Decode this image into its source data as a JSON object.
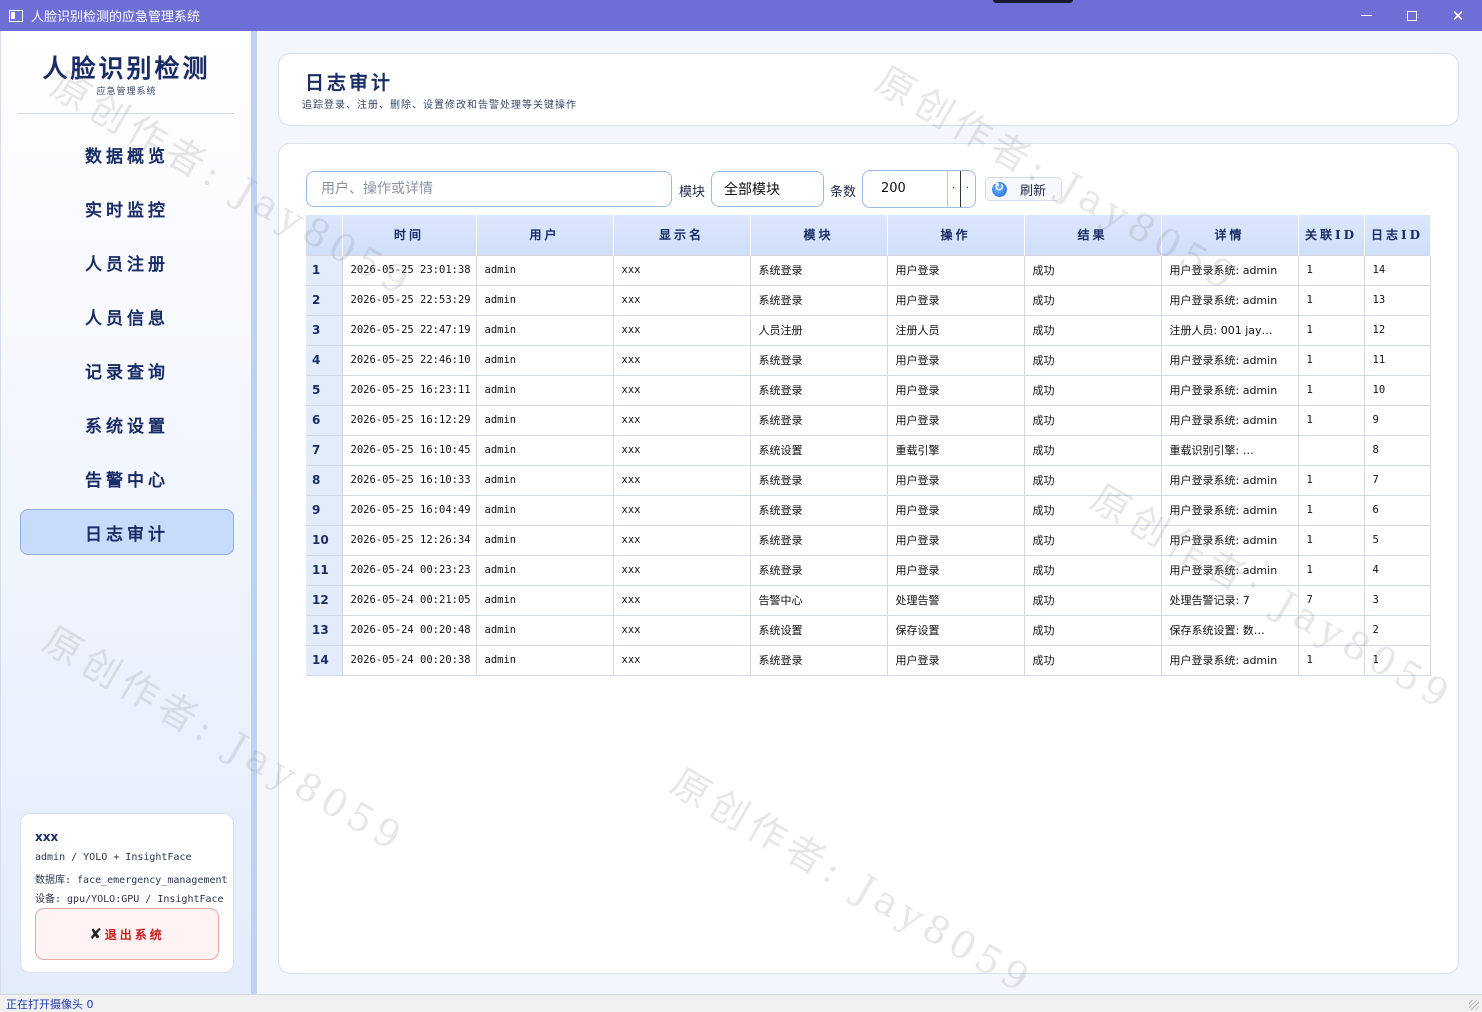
{
  "window": {
    "title": "人脸识别检测的应急管理系统"
  },
  "sidebar": {
    "brand_title": "人脸识别检测",
    "brand_subtitle": "应急管理系统",
    "nav": [
      {
        "label": "数据概览"
      },
      {
        "label": "实时监控"
      },
      {
        "label": "人员注册"
      },
      {
        "label": "人员信息"
      },
      {
        "label": "记录查询"
      },
      {
        "label": "系统设置"
      },
      {
        "label": "告警中心"
      },
      {
        "label": "日志审计",
        "active": true
      }
    ],
    "user": {
      "name": "xxx",
      "role_line": "admin / YOLO + InsightFace",
      "db_line": "数据库: face_emergency_management",
      "device_line": "设备: gpu/YOLO:GPU / InsightFace"
    },
    "logout_label": "退出系统"
  },
  "header": {
    "title": "日志审计",
    "subtitle": "追踪登录、注册、删除、设置修改和告警处理等关键操作"
  },
  "filters": {
    "search_placeholder": "用户、操作或详情",
    "module_label": "模块",
    "module_value": "全部模块",
    "count_label": "条数",
    "count_value": "200",
    "refresh_label": "刷新"
  },
  "table": {
    "columns": [
      "时间",
      "用户",
      "显示名",
      "模块",
      "操作",
      "结果",
      "详情",
      "关联ID",
      "日志ID"
    ],
    "rows": [
      {
        "n": "1",
        "time": "2026-05-25 23:01:38",
        "user": "admin",
        "display": "xxx",
        "module": "系统登录",
        "op": "用户登录",
        "result": "成功",
        "detail": "用户登录系统: admin",
        "ref": "1",
        "id": "14"
      },
      {
        "n": "2",
        "time": "2026-05-25 22:53:29",
        "user": "admin",
        "display": "xxx",
        "module": "系统登录",
        "op": "用户登录",
        "result": "成功",
        "detail": "用户登录系统: admin",
        "ref": "1",
        "id": "13"
      },
      {
        "n": "3",
        "time": "2026-05-25 22:47:19",
        "user": "admin",
        "display": "xxx",
        "module": "人员注册",
        "op": "注册人员",
        "result": "成功",
        "detail": "注册人员: 001 jay…",
        "ref": "1",
        "id": "12"
      },
      {
        "n": "4",
        "time": "2026-05-25 22:46:10",
        "user": "admin",
        "display": "xxx",
        "module": "系统登录",
        "op": "用户登录",
        "result": "成功",
        "detail": "用户登录系统: admin",
        "ref": "1",
        "id": "11"
      },
      {
        "n": "5",
        "time": "2026-05-25 16:23:11",
        "user": "admin",
        "display": "xxx",
        "module": "系统登录",
        "op": "用户登录",
        "result": "成功",
        "detail": "用户登录系统: admin",
        "ref": "1",
        "id": "10"
      },
      {
        "n": "6",
        "time": "2026-05-25 16:12:29",
        "user": "admin",
        "display": "xxx",
        "module": "系统登录",
        "op": "用户登录",
        "result": "成功",
        "detail": "用户登录系统: admin",
        "ref": "1",
        "id": "9"
      },
      {
        "n": "7",
        "time": "2026-05-25 16:10:45",
        "user": "admin",
        "display": "xxx",
        "module": "系统设置",
        "op": "重载引擎",
        "result": "成功",
        "detail": "重载识别引擎: …",
        "ref": "",
        "id": "8"
      },
      {
        "n": "8",
        "time": "2026-05-25 16:10:33",
        "user": "admin",
        "display": "xxx",
        "module": "系统登录",
        "op": "用户登录",
        "result": "成功",
        "detail": "用户登录系统: admin",
        "ref": "1",
        "id": "7"
      },
      {
        "n": "9",
        "time": "2026-05-25 16:04:49",
        "user": "admin",
        "display": "xxx",
        "module": "系统登录",
        "op": "用户登录",
        "result": "成功",
        "detail": "用户登录系统: admin",
        "ref": "1",
        "id": "6"
      },
      {
        "n": "10",
        "time": "2026-05-25 12:26:34",
        "user": "admin",
        "display": "xxx",
        "module": "系统登录",
        "op": "用户登录",
        "result": "成功",
        "detail": "用户登录系统: admin",
        "ref": "1",
        "id": "5"
      },
      {
        "n": "11",
        "time": "2026-05-24 00:23:23",
        "user": "admin",
        "display": "xxx",
        "module": "系统登录",
        "op": "用户登录",
        "result": "成功",
        "detail": "用户登录系统: admin",
        "ref": "1",
        "id": "4"
      },
      {
        "n": "12",
        "time": "2026-05-24 00:21:05",
        "user": "admin",
        "display": "xxx",
        "module": "告警中心",
        "op": "处理告警",
        "result": "成功",
        "detail": "处理告警记录: 7",
        "ref": "7",
        "id": "3"
      },
      {
        "n": "13",
        "time": "2026-05-24 00:20:48",
        "user": "admin",
        "display": "xxx",
        "module": "系统设置",
        "op": "保存设置",
        "result": "成功",
        "detail": "保存系统设置: 数…",
        "ref": "",
        "id": "2"
      },
      {
        "n": "14",
        "time": "2026-05-24 00:20:38",
        "user": "admin",
        "display": "xxx",
        "module": "系统登录",
        "op": "用户登录",
        "result": "成功",
        "detail": "用户登录系统: admin",
        "ref": "1",
        "id": "1"
      }
    ]
  },
  "status_bar": {
    "text": "正在打开摄像头 0"
  },
  "watermark": {
    "text": "原创作者: Jay8059"
  }
}
